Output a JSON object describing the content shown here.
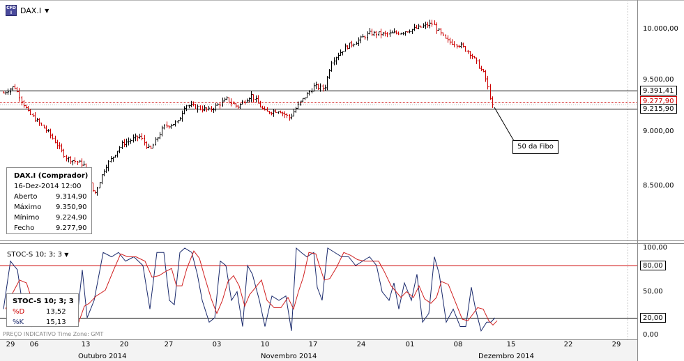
{
  "header": {
    "symbol": "DAX.I",
    "icon": "cfd-instrument-icon",
    "dropdown": "▼"
  },
  "price_axis": {
    "labels": [
      "10.000,00",
      "9.500,00",
      "9.000,00",
      "8.500,00"
    ],
    "boxed": [
      "9.391,41",
      "9.277,90",
      "9.215,90"
    ]
  },
  "info": {
    "title": "DAX.I (Comprador)",
    "datetime": "16-Dez-2014 12:00",
    "rows": [
      {
        "k": "Aberto",
        "v": "9.314,90"
      },
      {
        "k": "Máximo",
        "v": "9.350,90"
      },
      {
        "k": "Mínimo",
        "v": "9.224,90"
      },
      {
        "k": "Fecho",
        "v": "9.277,90"
      }
    ]
  },
  "annotation": "50 da Fibo",
  "stoc": {
    "title": "STOC-S 10; 3; 3",
    "dropdown": "▼",
    "axis_labels": [
      "100,00",
      "50,00",
      "0,00"
    ],
    "boxed": [
      "80,00",
      "20,00"
    ],
    "box_title": "STOC-S 10; 3; 3",
    "rows": [
      {
        "k": "%D",
        "v": "13,52",
        "color": "#cc0000"
      },
      {
        "k": "%K",
        "v": "15,13",
        "color": "#1a2a6c"
      }
    ]
  },
  "footer": "PREÇO INDICATIVO   Time Zone: GMT",
  "x_axis": {
    "days": [
      "29",
      "06",
      "13",
      "20",
      "27",
      "03",
      "10",
      "17",
      "24",
      "01",
      "08",
      "15",
      "22",
      "29"
    ],
    "months": [
      "Outubro 2014",
      "Novembro 2014",
      "Dezembro 2014"
    ]
  },
  "colors": {
    "up": "#000000",
    "down": "#cc0000",
    "k_line": "#1a2a6c",
    "d_line": "#d02020"
  }
}
